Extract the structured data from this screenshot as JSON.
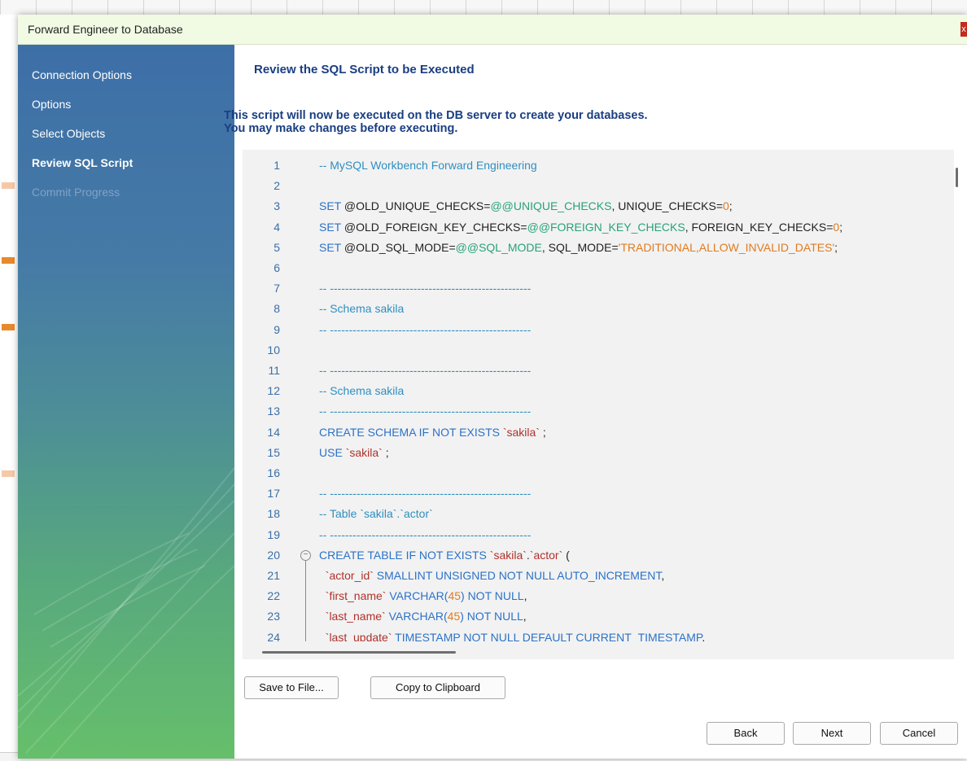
{
  "dialog": {
    "title": "Forward Engineer to Database",
    "close_label": "x"
  },
  "sidebar": {
    "items": [
      {
        "label": "Connection Options",
        "state": "done"
      },
      {
        "label": "Options",
        "state": "done"
      },
      {
        "label": "Select Objects",
        "state": "done"
      },
      {
        "label": "Review SQL Script",
        "state": "active"
      },
      {
        "label": "Commit Progress",
        "state": "pending"
      }
    ]
  },
  "main": {
    "heading": "Review the SQL Script to be Executed",
    "description_line1": "This script will now be executed on the DB server to create your databases.",
    "description_line2": "You may make changes before executing."
  },
  "script": {
    "lines": [
      {
        "n": "1",
        "parts": [
          [
            "cm",
            "-- MySQL Workbench Forward Engineering"
          ]
        ]
      },
      {
        "n": "2",
        "parts": []
      },
      {
        "n": "3",
        "parts": [
          [
            "kw",
            "SET "
          ],
          [
            "id",
            "@OLD_UNIQUE_CHECKS"
          ],
          [
            "id",
            "="
          ],
          [
            "var",
            "@@UNIQUE_CHECKS"
          ],
          [
            "id",
            ", UNIQUE_CHECKS"
          ],
          [
            "id",
            "="
          ],
          [
            "str",
            "0"
          ],
          [
            "id",
            ";"
          ]
        ]
      },
      {
        "n": "4",
        "parts": [
          [
            "kw",
            "SET "
          ],
          [
            "id",
            "@OLD_FOREIGN_KEY_CHECKS"
          ],
          [
            "id",
            "="
          ],
          [
            "var",
            "@@FOREIGN_KEY_CHECKS"
          ],
          [
            "id",
            ", FOREIGN_KEY_CHECKS"
          ],
          [
            "id",
            "="
          ],
          [
            "str",
            "0"
          ],
          [
            "id",
            ";"
          ]
        ]
      },
      {
        "n": "5",
        "parts": [
          [
            "kw",
            "SET "
          ],
          [
            "id",
            "@OLD_SQL_MODE"
          ],
          [
            "id",
            "="
          ],
          [
            "var",
            "@@SQL_MODE"
          ],
          [
            "id",
            ", SQL_MODE"
          ],
          [
            "id",
            "="
          ],
          [
            "str",
            "'TRADITIONAL,ALLOW_INVALID_DATES'"
          ],
          [
            "id",
            ";"
          ]
        ]
      },
      {
        "n": "6",
        "parts": []
      },
      {
        "n": "7",
        "parts": [
          [
            "cm",
            "-- -----------------------------------------------------"
          ]
        ]
      },
      {
        "n": "8",
        "parts": [
          [
            "cm",
            "-- Schema sakila"
          ]
        ]
      },
      {
        "n": "9",
        "parts": [
          [
            "cm",
            "-- -----------------------------------------------------"
          ]
        ]
      },
      {
        "n": "10",
        "parts": []
      },
      {
        "n": "11",
        "parts": [
          [
            "cm",
            "-- -----------------------------------------------------"
          ]
        ]
      },
      {
        "n": "12",
        "parts": [
          [
            "cm",
            "-- Schema sakila"
          ]
        ]
      },
      {
        "n": "13",
        "parts": [
          [
            "cm",
            "-- -----------------------------------------------------"
          ]
        ]
      },
      {
        "n": "14",
        "parts": [
          [
            "kw",
            "CREATE SCHEMA IF NOT EXISTS "
          ],
          [
            "q",
            "`sakila`"
          ],
          [
            "id",
            " ;"
          ]
        ]
      },
      {
        "n": "15",
        "parts": [
          [
            "kw",
            "USE "
          ],
          [
            "q",
            "`sakila`"
          ],
          [
            "id",
            " ;"
          ]
        ]
      },
      {
        "n": "16",
        "parts": []
      },
      {
        "n": "17",
        "parts": [
          [
            "cm",
            "-- -----------------------------------------------------"
          ]
        ]
      },
      {
        "n": "18",
        "parts": [
          [
            "cm",
            "-- Table `sakila`.`actor`"
          ]
        ]
      },
      {
        "n": "19",
        "parts": [
          [
            "cm",
            "-- -----------------------------------------------------"
          ]
        ]
      },
      {
        "n": "20",
        "fold": true,
        "parts": [
          [
            "kw",
            "CREATE TABLE IF NOT EXISTS "
          ],
          [
            "q",
            "`sakila`"
          ],
          [
            "id",
            "."
          ],
          [
            "q",
            "`actor`"
          ],
          [
            "id",
            " ("
          ]
        ]
      },
      {
        "n": "21",
        "parts": [
          [
            "id",
            "  "
          ],
          [
            "q",
            "`actor_id`"
          ],
          [
            "kw",
            " SMALLINT UNSIGNED NOT NULL AUTO_INCREMENT"
          ],
          [
            "id",
            ","
          ]
        ]
      },
      {
        "n": "22",
        "parts": [
          [
            "id",
            "  "
          ],
          [
            "q",
            "`first_name`"
          ],
          [
            "kw",
            " VARCHAR("
          ],
          [
            "str",
            "45"
          ],
          [
            "kw",
            ") NOT NULL"
          ],
          [
            "id",
            ","
          ]
        ]
      },
      {
        "n": "23",
        "parts": [
          [
            "id",
            "  "
          ],
          [
            "q",
            "`last_name`"
          ],
          [
            "kw",
            " VARCHAR("
          ],
          [
            "str",
            "45"
          ],
          [
            "kw",
            ") NOT NULL"
          ],
          [
            "id",
            ","
          ]
        ]
      },
      {
        "n": "24",
        "parts": [
          [
            "id",
            "  "
          ],
          [
            "q",
            "`last_update`"
          ],
          [
            "kw",
            " TIMESTAMP NOT NULL DEFAULT CURRENT_TIMESTAMP"
          ],
          [
            "id",
            ","
          ]
        ]
      }
    ]
  },
  "buttons": {
    "save_to_file": "Save to File...",
    "copy_to_clipboard": "Copy to Clipboard",
    "back": "Back",
    "next": "Next",
    "cancel": "Cancel"
  },
  "colors": {
    "heading_blue": "#1a3e82",
    "comment": "#2f8fc0",
    "keyword": "#2b72c8",
    "variable": "#27a27a",
    "string": "#e07b1f",
    "quoted_identifier": "#b0312b"
  }
}
